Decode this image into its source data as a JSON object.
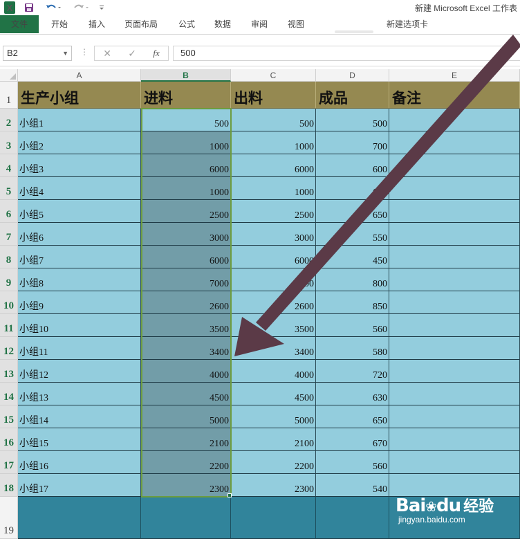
{
  "titlebar": {
    "excel_icon": "X",
    "save_icon": "save-icon",
    "undo_icon": "undo-icon",
    "redo_icon": "redo-icon",
    "customize_icon": "customize-qat-icon",
    "window_title": "新建 Microsoft Excel 工作表"
  },
  "ribbon": {
    "tabs": [
      "文件",
      "开始",
      "插入",
      "页面布局",
      "公式",
      "数据",
      "审阅",
      "视图",
      "新建选项卡"
    ],
    "accent": "#217346"
  },
  "formula_bar": {
    "name_box": "B2",
    "formula_value": "500",
    "cancel_icon": "✕",
    "enter_icon": "✓",
    "function_icon": "fx"
  },
  "columns": [
    "A",
    "B",
    "C",
    "D",
    "E"
  ],
  "row_numbers": [
    "1",
    "2",
    "3",
    "4",
    "5",
    "6",
    "7",
    "8",
    "9",
    "10",
    "11",
    "12",
    "13",
    "14",
    "15",
    "16",
    "17",
    "18",
    "19"
  ],
  "table": {
    "headers": [
      "生产小组",
      "进料",
      "出料",
      "成品",
      "备注"
    ],
    "rows": [
      [
        "小组1",
        "500",
        "500",
        "500",
        ""
      ],
      [
        "小组2",
        "1000",
        "1000",
        "700",
        ""
      ],
      [
        "小组3",
        "6000",
        "6000",
        "600",
        ""
      ],
      [
        "小组4",
        "1000",
        "1000",
        "600",
        ""
      ],
      [
        "小组5",
        "2500",
        "2500",
        "650",
        ""
      ],
      [
        "小组6",
        "3000",
        "3000",
        "550",
        ""
      ],
      [
        "小组7",
        "6000",
        "6000",
        "450",
        ""
      ],
      [
        "小组8",
        "7000",
        "7000",
        "800",
        ""
      ],
      [
        "小组9",
        "2600",
        "2600",
        "850",
        ""
      ],
      [
        "小组10",
        "3500",
        "3500",
        "560",
        ""
      ],
      [
        "小组11",
        "3400",
        "3400",
        "580",
        ""
      ],
      [
        "小组12",
        "4000",
        "4000",
        "720",
        ""
      ],
      [
        "小组13",
        "4500",
        "4500",
        "630",
        ""
      ],
      [
        "小组14",
        "5000",
        "5000",
        "650",
        ""
      ],
      [
        "小组15",
        "2100",
        "2100",
        "670",
        ""
      ],
      [
        "小组16",
        "2200",
        "2200",
        "560",
        ""
      ],
      [
        "小组17",
        "2300",
        "2300",
        "540",
        ""
      ]
    ]
  },
  "colors": {
    "header_fill": "#958951",
    "data_fill": "#93cddd",
    "selected_fill": "#729da8",
    "row19_fill": "#31849b",
    "arrow": "#5b3a47",
    "selection_border": "#6d9c3f"
  },
  "watermark": {
    "logo": "Bai",
    "logo_tail": "du",
    "cn": "经验",
    "url": "jingyan.baidu.com"
  }
}
